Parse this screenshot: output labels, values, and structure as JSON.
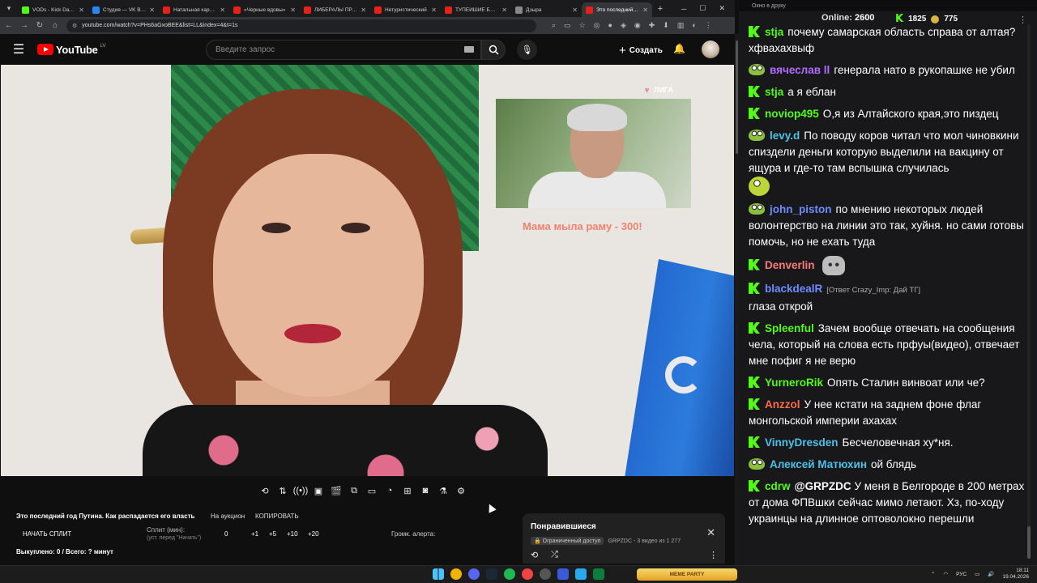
{
  "browser": {
    "tabs": [
      {
        "title": "VODs - Kick Dashb",
        "icon": "kick"
      },
      {
        "title": "Студия — VK Видео",
        "icon": "vk"
      },
      {
        "title": "Натальная карта Я",
        "icon": "yt"
      },
      {
        "title": "«Черные вдовы»",
        "icon": "yt"
      },
      {
        "title": "ЛИБЕРАЛЫ ПРАВЫ",
        "icon": "yt"
      },
      {
        "title": "Нетуристический",
        "icon": "yt"
      },
      {
        "title": "ТУПЕЙШИЕ БЕЛЫЕ",
        "icon": "yt"
      },
      {
        "title": "Дзыра",
        "icon": "doc"
      },
      {
        "title": "Это последний год",
        "icon": "yt",
        "active": true
      }
    ],
    "url": "youtube.com/watch?v=PHs6aGxoBEE&list=LL&index=4&t=1s"
  },
  "youtube": {
    "logo_text": "YouTube",
    "country": "LV",
    "search_placeholder": "Введите запрос",
    "create_label": "Создать"
  },
  "video": {
    "overlay_text": "Мама мыла раму - 300!",
    "pip_logo": "ЛИГА"
  },
  "below": {
    "video_title": "Это последний год Путина. Как распадается его власть",
    "auction": "На аукцион",
    "copy": "КОПИРОВАТЬ",
    "start_split": "НАЧАТЬ СПЛИТ",
    "split_label": "Сплит (мин):",
    "split_hint": "(уст. перед \"Начать\")",
    "split_value": "0",
    "increments": [
      "+1",
      "+5",
      "+10",
      "+20"
    ],
    "alert_label": "Громк. алерта:",
    "bought": "Выкуплено: 0 / Всего: ? минут"
  },
  "liked": {
    "title": "Понравившиеся",
    "access": "Ограниченный доступ",
    "meta": "GRPZDC - 3 видео из 1 277"
  },
  "chat": {
    "window_title": "Окно в друку",
    "online_label": "Online:",
    "online_count": "2600",
    "kick_count": "1825",
    "coin_count": "775",
    "messages": [
      {
        "badge": "k",
        "user": "stja",
        "color": "#53fc18",
        "text": "почему самарская область справа от алтая? хфвахахвыф"
      },
      {
        "badge": "pepe",
        "user": "вячеслав ll",
        "color": "#b16cff",
        "text": "генерала нато в рукопашке не убил"
      },
      {
        "badge": "k",
        "user": "stja",
        "color": "#53fc18",
        "text": "а я еблан"
      },
      {
        "badge": "k",
        "user": "noviop495",
        "color": "#53fc18",
        "text": "О,я из Алтайского края,это пиздец"
      },
      {
        "badge": "pepe",
        "user": "levy.d",
        "color": "#4ec1e8",
        "text": "По поводу коров читал что мол чиновкини спиздели деньги которую выделили на вакцину от ящура и где-то там вспышка случилась",
        "emote": "pepe"
      },
      {
        "badge": "pepe",
        "user": "john_piston",
        "color": "#6f8cff",
        "text": "по мнению некоторых людей волонтерство на линии это так, хуйня. но сами готовы помочь, но не ехать туда"
      },
      {
        "badge": "k",
        "user": "Denverlin",
        "color": "#ff7b7b",
        "text": "",
        "emote": "cat"
      },
      {
        "badge": "k",
        "user": "blackdealR",
        "color": "#6f8cff",
        "reply": "[Ответ Crazy_Imp: Дай ТГ]",
        "text": "глаза открой"
      },
      {
        "badge": "k",
        "user": "Spleenful",
        "color": "#53fc18",
        "text": "Зачем вообще отвечать на сообщения чела, который на слова есть прфуы(видео), отвечает мне пофиг я не верю"
      },
      {
        "badge": "k",
        "user": "YurneroRik",
        "color": "#53fc18",
        "text": "Опять Сталин винвоат или че?"
      },
      {
        "badge": "k",
        "user": "Anzzol",
        "color": "#ff6b4a",
        "text": "У нее кстати на заднем фоне флаг монгольской империи ахахах"
      },
      {
        "badge": "k",
        "user": "VinnyDresden",
        "color": "#4ec1e8",
        "text": "Бесчеловечная ху*ня."
      },
      {
        "badge": "pepe",
        "user": "Алексей Матюхин",
        "color": "#4ec1e8",
        "text": "ой блядь"
      },
      {
        "badge": "k",
        "user": "cdrw",
        "color": "#53fc18",
        "mention": "@GRPZDC",
        "text": "У меня в Белгороде в 200 метрах от дома ФПВшки сейчас мимо летают. Хз, по-ходу украинцы на длинное оптоволокно перешли"
      }
    ]
  },
  "taskbar": {
    "meme_label": "MEME PARTY",
    "lang": "РУС",
    "time": "18:11",
    "date": "19.04.2026"
  }
}
